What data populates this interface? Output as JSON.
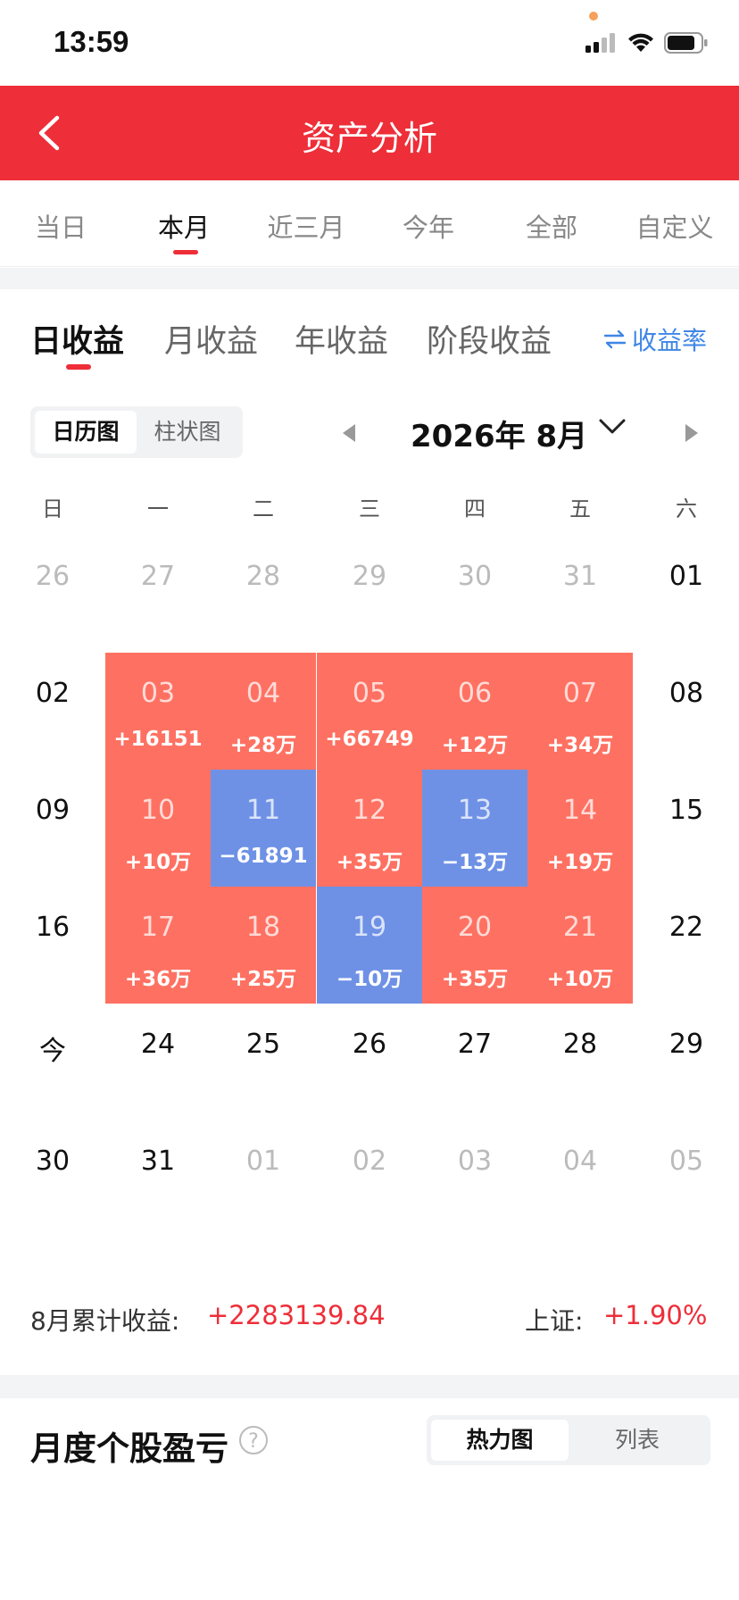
{
  "status_bar": {
    "time": "13:59"
  },
  "header": {
    "title": "资产分析"
  },
  "period_tabs": [
    "当日",
    "本月",
    "近三月",
    "今年",
    "全部",
    "自定义"
  ],
  "period_active": 1,
  "type_tabs": [
    "日收益",
    "月收益",
    "年收益",
    "阶段收益"
  ],
  "type_active": 0,
  "rate_link": "收益率",
  "view_toggle": {
    "calendar": "日历图",
    "bar": "柱状图"
  },
  "month_label": "2026年 8月",
  "weekdays": [
    "日",
    "一",
    "二",
    "三",
    "四",
    "五",
    "六"
  ],
  "calendar": [
    [
      {
        "day": "26",
        "muted": true
      },
      {
        "day": "27",
        "muted": true
      },
      {
        "day": "28",
        "muted": true
      },
      {
        "day": "29",
        "muted": true
      },
      {
        "day": "30",
        "muted": true
      },
      {
        "day": "31",
        "muted": true
      },
      {
        "day": "01"
      }
    ],
    [
      {
        "day": "02"
      },
      {
        "day": "03",
        "value": "+16151",
        "tone": "red"
      },
      {
        "day": "04",
        "value": "+28万",
        "tone": "red"
      },
      {
        "day": "05",
        "value": "+66749",
        "tone": "red"
      },
      {
        "day": "06",
        "value": "+12万",
        "tone": "red"
      },
      {
        "day": "07",
        "value": "+34万",
        "tone": "red"
      },
      {
        "day": "08"
      }
    ],
    [
      {
        "day": "09"
      },
      {
        "day": "10",
        "value": "+10万",
        "tone": "red"
      },
      {
        "day": "11",
        "value": "−61891",
        "tone": "blue"
      },
      {
        "day": "12",
        "value": "+35万",
        "tone": "red"
      },
      {
        "day": "13",
        "value": "−13万",
        "tone": "blue"
      },
      {
        "day": "14",
        "value": "+19万",
        "tone": "red"
      },
      {
        "day": "15"
      }
    ],
    [
      {
        "day": "16"
      },
      {
        "day": "17",
        "value": "+36万",
        "tone": "red"
      },
      {
        "day": "18",
        "value": "+25万",
        "tone": "red"
      },
      {
        "day": "19",
        "value": "−10万",
        "tone": "blue"
      },
      {
        "day": "20",
        "value": "+35万",
        "tone": "red"
      },
      {
        "day": "21",
        "value": "+10万",
        "tone": "red"
      },
      {
        "day": "22"
      }
    ],
    [
      {
        "day": "今"
      },
      {
        "day": "24"
      },
      {
        "day": "25"
      },
      {
        "day": "26"
      },
      {
        "day": "27"
      },
      {
        "day": "28"
      },
      {
        "day": "29"
      }
    ],
    [
      {
        "day": "30"
      },
      {
        "day": "31"
      },
      {
        "day": "01",
        "muted": true
      },
      {
        "day": "02",
        "muted": true
      },
      {
        "day": "03",
        "muted": true
      },
      {
        "day": "04",
        "muted": true
      },
      {
        "day": "05",
        "muted": true
      }
    ]
  ],
  "summary": {
    "label": "8月累计收益:",
    "value": "+2283139.84",
    "index_label": "上证:",
    "index_value": "+1.90%"
  },
  "stock_section": {
    "title": "月度个股盈亏",
    "toggle_heatmap": "热力图",
    "toggle_list": "列表"
  },
  "colors": {
    "brand_red": "#ee2e38",
    "gain_cell": "#fe7162",
    "loss_cell": "#6e91e6",
    "link_blue": "#3f86e6"
  }
}
